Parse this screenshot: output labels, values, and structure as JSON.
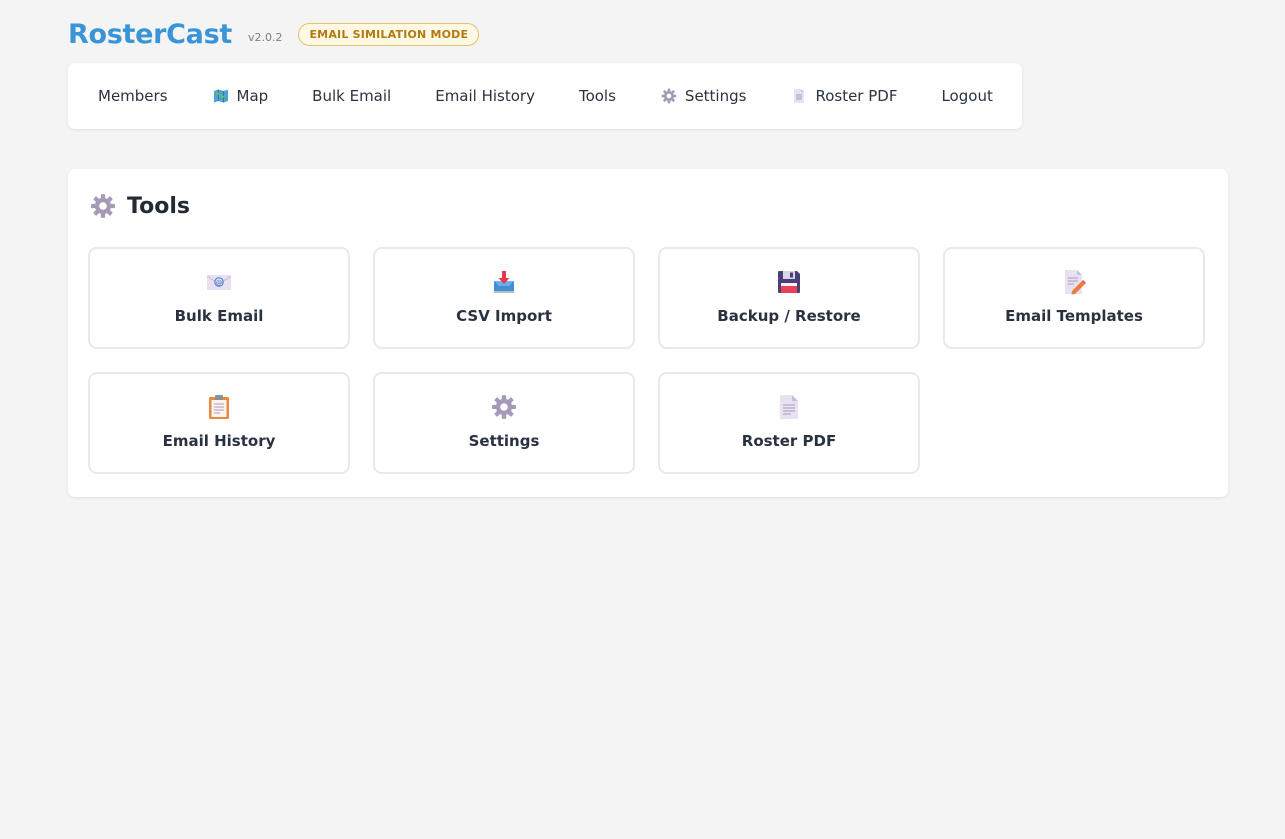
{
  "app": {
    "brand": "RosterCast",
    "version": "v2.0.2",
    "mode_badge": "EMAIL SIMILATION MODE"
  },
  "nav": {
    "items": [
      {
        "label": "Members",
        "icon": ""
      },
      {
        "label": "Map",
        "icon": "map-icon"
      },
      {
        "label": "Bulk Email",
        "icon": ""
      },
      {
        "label": "Email History",
        "icon": ""
      },
      {
        "label": "Tools",
        "icon": ""
      },
      {
        "label": "Settings",
        "icon": "gear-icon"
      },
      {
        "label": "Roster PDF",
        "icon": "document-icon"
      },
      {
        "label": "Logout",
        "icon": ""
      }
    ]
  },
  "tools": {
    "title": "Tools",
    "title_icon": "gear-icon",
    "cards": [
      {
        "label": "Bulk Email",
        "icon": "email-envelope-icon"
      },
      {
        "label": "CSV Import",
        "icon": "inbox-download-icon"
      },
      {
        "label": "Backup / Restore",
        "icon": "floppy-disk-icon"
      },
      {
        "label": "Email Templates",
        "icon": "memo-pencil-icon"
      },
      {
        "label": "Email History",
        "icon": "clipboard-icon"
      },
      {
        "label": "Settings",
        "icon": "gear-icon"
      },
      {
        "label": "Roster PDF",
        "icon": "document-icon"
      }
    ]
  },
  "colors": {
    "brand": "#3a95d6",
    "badge_text": "#b27a10",
    "background": "#f4f4f4"
  }
}
